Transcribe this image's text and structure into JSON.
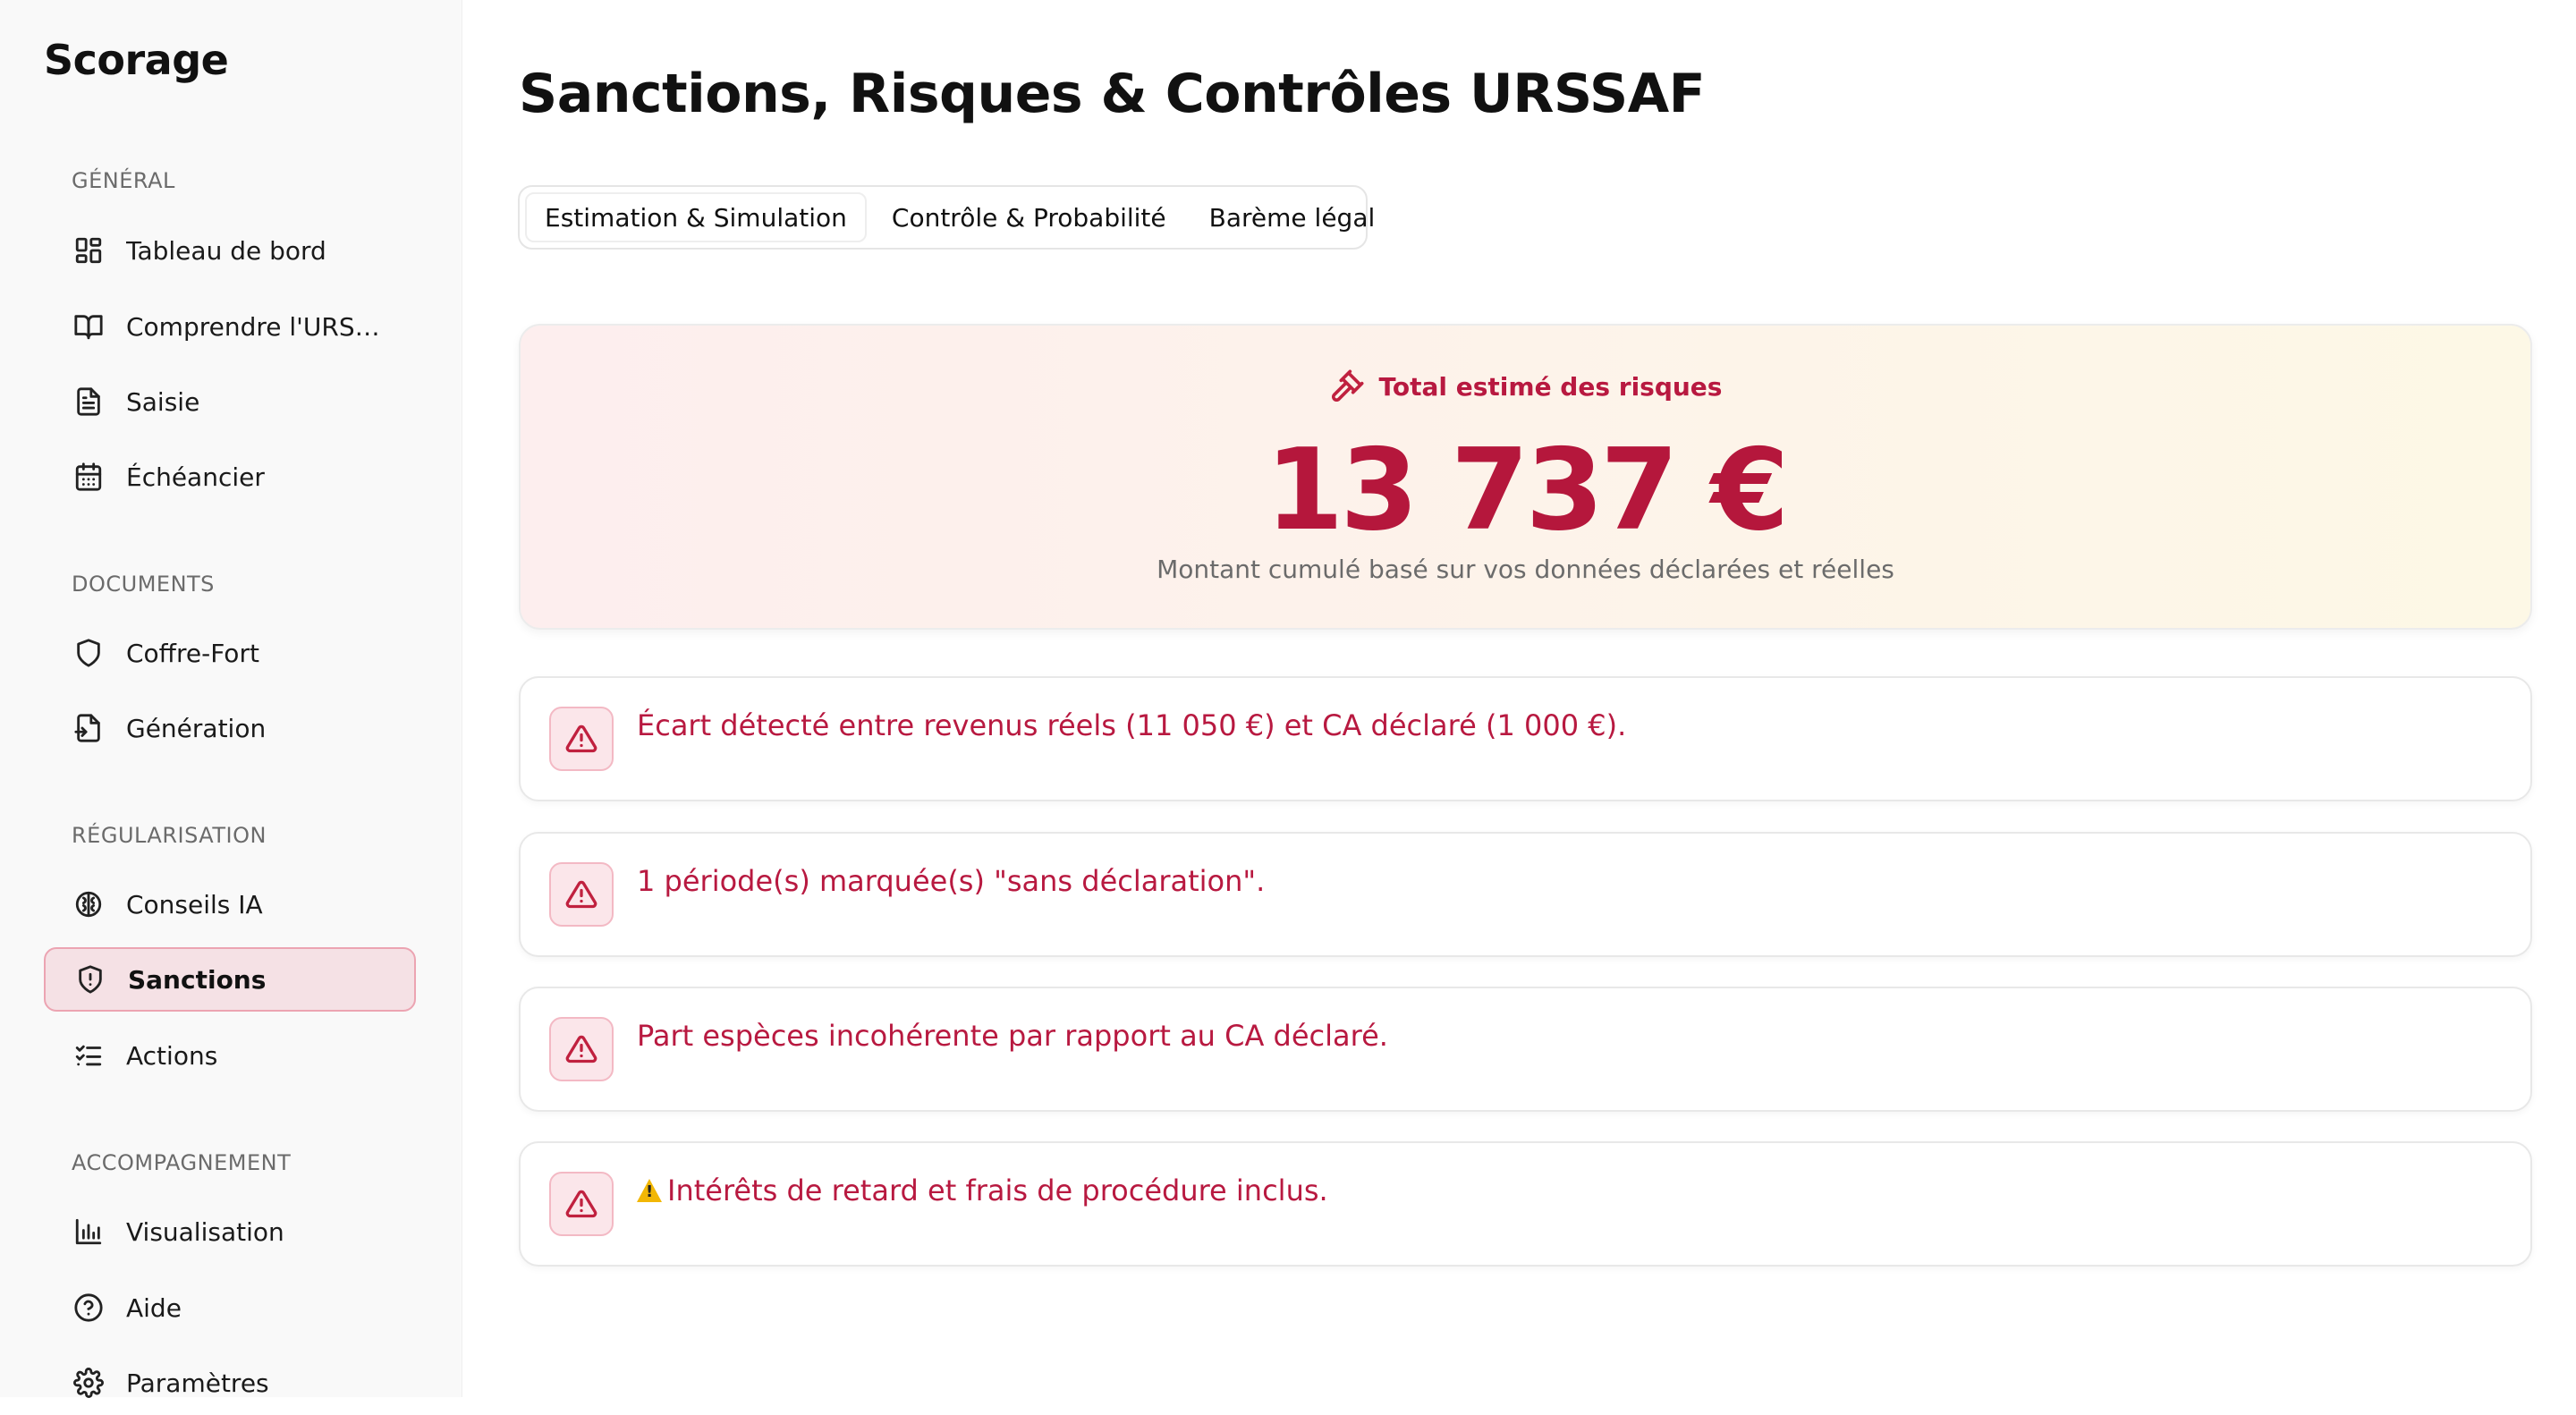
{
  "app": {
    "brand": "Scorage"
  },
  "sidebar": {
    "sections": [
      {
        "title": "GÉNÉRAL"
      },
      {
        "title": "DOCUMENTS"
      },
      {
        "title": "RÉGULARISATION"
      },
      {
        "title": "ACCOMPAGNEMENT"
      }
    ],
    "items": [
      {
        "label": "Tableau de bord",
        "icon": "dashboard-icon"
      },
      {
        "label": "Comprendre l'URSSAF",
        "icon": "book-icon"
      },
      {
        "label": "Saisie",
        "icon": "document-icon"
      },
      {
        "label": "Échéancier",
        "icon": "calendar-icon"
      },
      {
        "label": "Coffre-Fort",
        "icon": "shield-icon"
      },
      {
        "label": "Génération",
        "icon": "file-export-icon"
      },
      {
        "label": "Conseils IA",
        "icon": "brain-icon"
      },
      {
        "label": "Sanctions",
        "icon": "shield-alert-icon",
        "active": true
      },
      {
        "label": "Actions",
        "icon": "list-checks-icon"
      },
      {
        "label": "Visualisation",
        "icon": "bar-chart-icon"
      },
      {
        "label": "Aide",
        "icon": "help-circle-icon"
      },
      {
        "label": "Paramètres",
        "icon": "gear-icon"
      }
    ]
  },
  "main": {
    "title": "Sanctions, Risques & Contrôles URSSAF",
    "tabs": [
      {
        "label": "Estimation & Simulation",
        "active": true
      },
      {
        "label": "Contrôle & Probabilité"
      },
      {
        "label": "Barème légal"
      }
    ],
    "total": {
      "label": "Total estimé des risques",
      "amount": "13 737 €",
      "subtitle": "Montant cumulé basé sur vos données déclarées et réelles"
    },
    "alerts": [
      {
        "text": "Écart détecté entre revenus réels (11 050 €) et CA déclaré (1 000 €)."
      },
      {
        "text": "1 période(s) marquée(s) \"sans déclaration\"."
      },
      {
        "text": "Part espèces incohérente par rapport au CA déclaré."
      },
      {
        "text": "Intérêts de retard et frais de procédure inclus.",
        "emoji": "warning"
      }
    ]
  },
  "colors": {
    "accent": "#b81940",
    "active_bg": "#f5e1e5",
    "active_border": "#eca4b2"
  }
}
